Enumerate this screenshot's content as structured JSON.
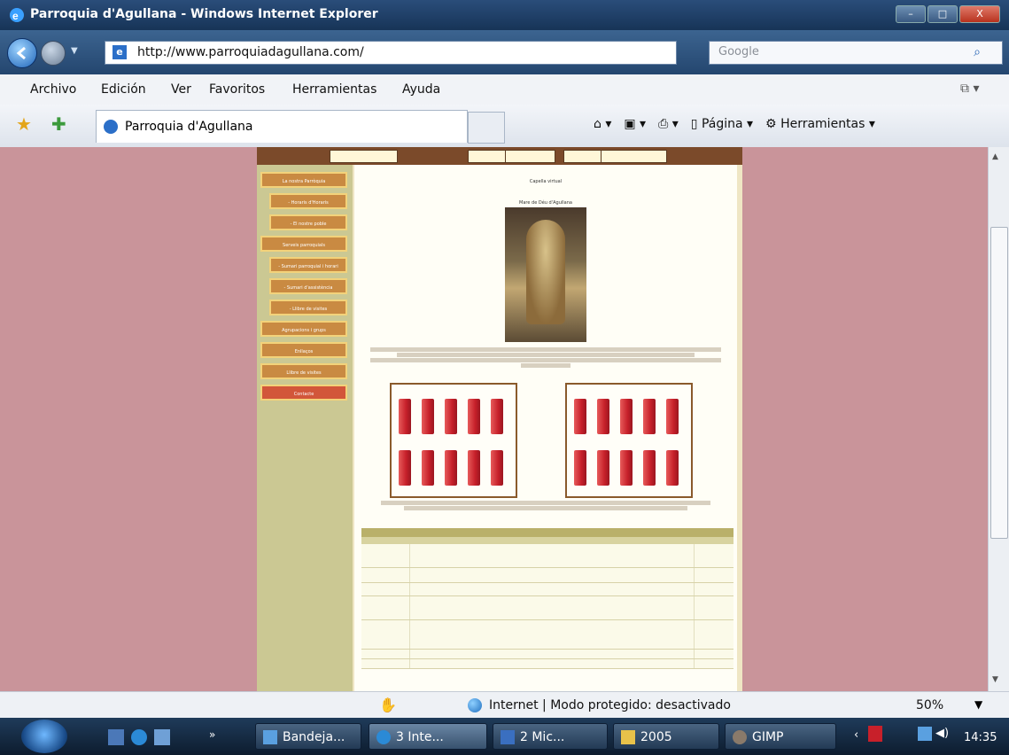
{
  "window": {
    "title": "Parroquia d'Agullana - Windows Internet Explorer",
    "buttons": [
      "–",
      "□",
      "X"
    ]
  },
  "address": {
    "url": "http://www.parroquiadagullana.com/",
    "search_placeholder": "Google"
  },
  "menu": [
    "Archivo",
    "Edición",
    "Ver",
    "Favoritos",
    "Herramientas",
    "Ayuda"
  ],
  "tab": {
    "label": "Parroquia d'Agullana"
  },
  "commandbar": {
    "page_label": "Página",
    "tools_label": "Herramientas"
  },
  "site": {
    "sidebar_items": [
      "La nostra Parròquia",
      "- Horaris d'Horaris",
      "- El nostre poble",
      "Serveis parroquials",
      "- Sumari parroquial i horari",
      "- Sumari d'assistència",
      "- Llibre de visites",
      "Agrupacions i grups",
      "Enllaços",
      "Llibre de visites",
      "Contacte"
    ],
    "heading": "Capella virtual",
    "photo_caption": "Mare de Déu d'Agullana"
  },
  "status": {
    "zone": "Internet | Modo protegido: desactivado",
    "zoom": "50%"
  },
  "taskbar": {
    "tasks": [
      "Bandeja...",
      "3 Inte...",
      "2 Mic...",
      "2005",
      "GIMP"
    ],
    "clock": "14:35"
  }
}
